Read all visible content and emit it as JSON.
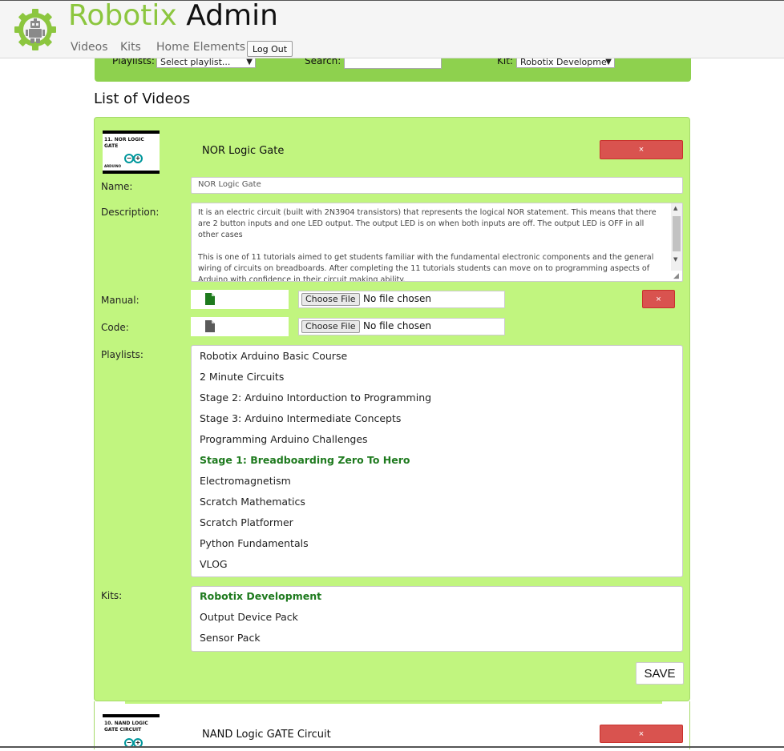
{
  "header": {
    "brand_part1": "Robotix",
    "brand_part2": "Admin",
    "nav": [
      "Videos",
      "Kits",
      "Home Elements"
    ],
    "logout_label": "Log Out",
    "logo_icon": "robot-gear-logo-icon"
  },
  "filters": {
    "playlists_label": "Playlists:",
    "playlists_value": "Select playlist...",
    "search_label": "Search:",
    "search_value": "",
    "kit_label": "Kit:",
    "kit_value": "Robotix Developme"
  },
  "list_title": "List of Videos",
  "colors": {
    "accent": "#8cc63f",
    "filter_bar": "#8ed14e",
    "card_bg": "#c1f57f",
    "delete": "#d9534f",
    "selected_text": "#1e7a1e"
  },
  "videos": [
    {
      "thumb_text": "11. NOR LOGIC GATE",
      "thumb_brand": "ARDUINO",
      "title": "NOR Logic Gate",
      "delete_label": "×",
      "name_label": "Name:",
      "name_value": "NOR Logic Gate",
      "description_label": "Description:",
      "description": "It is an electric circuit (built with 2N3904 transistors) that represents the logical NOR statement. This means that there are 2 button inputs and one LED output. The output LED is on when both inputs are off. The output LED is OFF in all other cases\n\nThis is one of 11 tutorials aimed to get students familiar with the fundamental electronic components and the general wiring of circuits on breadboards. After completing the 11 tutorials students can move on to programming aspects of Arduino with confidence in their circuit making ability.",
      "manual_label": "Manual:",
      "code_label": "Code:",
      "choose_file_label": "Choose File",
      "no_file_label": "No file chosen",
      "manual_delete_label": "×",
      "playlists_label": "Playlists:",
      "playlists": [
        {
          "name": "Robotix Arduino Basic Course",
          "selected": false
        },
        {
          "name": "2 Minute Circuits",
          "selected": false
        },
        {
          "name": "Stage 2: Arduino Intorduction to Programming",
          "selected": false
        },
        {
          "name": "Stage 3: Arduino Intermediate Concepts",
          "selected": false
        },
        {
          "name": "Programming Arduino Challenges",
          "selected": false
        },
        {
          "name": "Stage 1: Breadboarding Zero To Hero",
          "selected": true
        },
        {
          "name": "Electromagnetism",
          "selected": false
        },
        {
          "name": "Scratch Mathematics",
          "selected": false
        },
        {
          "name": "Scratch Platformer",
          "selected": false
        },
        {
          "name": "Python Fundamentals",
          "selected": false
        },
        {
          "name": "VLOG",
          "selected": false
        }
      ],
      "kits_label": "Kits:",
      "kits": [
        {
          "name": "Robotix Development",
          "selected": true
        },
        {
          "name": "Output Device Pack",
          "selected": false
        },
        {
          "name": "Sensor Pack",
          "selected": false
        }
      ],
      "save_label": "SAVE"
    },
    {
      "thumb_text": "10. NAND LOGIC GATE CIRCUIT",
      "title": "NAND Logic GATE Circuit",
      "delete_label": "×"
    }
  ]
}
